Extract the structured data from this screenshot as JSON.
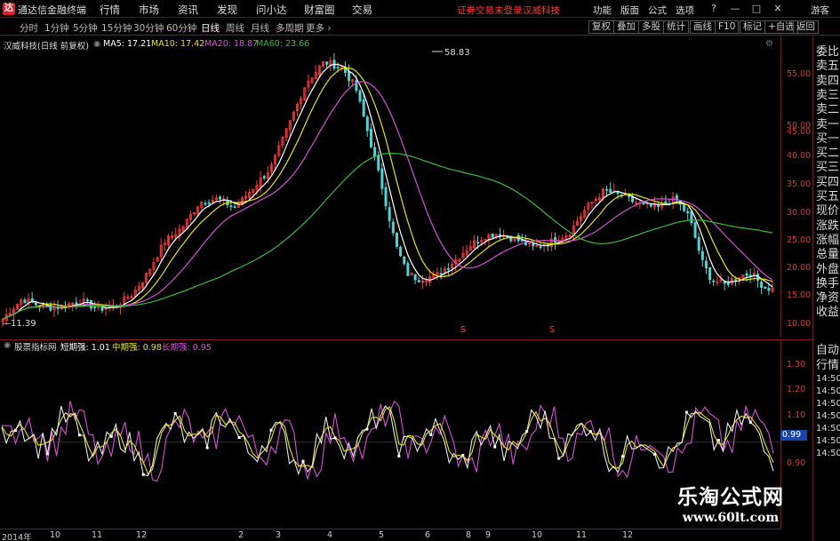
{
  "app": {
    "title": "通达信金融终端",
    "logo_glyph": "达"
  },
  "menu": [
    "行情",
    "市场",
    "资讯",
    "发现",
    "问小达",
    "财富圈",
    "交易"
  ],
  "status_warning": "证券交易未登录",
  "stock_tag": "汉威科技",
  "right_menu": [
    "功能",
    "版面",
    "公式",
    "选项"
  ],
  "window_buttons": [
    "?",
    "—",
    "□",
    "✕"
  ],
  "user_label": "游客",
  "periods": [
    "分时",
    "1分钟",
    "5分钟",
    "15分钟",
    "30分钟",
    "60分钟",
    "日线",
    "周线",
    "月线",
    "多周期",
    "更多 ›"
  ],
  "active_period": "日线",
  "toolbar": [
    "复权",
    "叠加",
    "多股",
    "统计",
    "画线",
    "F10",
    "标记",
    "+自选",
    "返回"
  ],
  "main_legend": {
    "stock": "汉威科技(日线 前复权)",
    "ma5": "MA5: 17.21",
    "ma10": "MA10: 17.42",
    "ma20": "MA20: 18.87",
    "ma60": "MA60: 23.66"
  },
  "sub_legend": {
    "name": "股票指标网",
    "short": "短期强: 1.01",
    "mid": "中期强: 0.98",
    "long": "长期强: 0.95"
  },
  "annotations": {
    "high": "58.83",
    "low": "11.39",
    "marker": "S"
  },
  "main_axis_ticks": [
    "55.00",
    "50.00",
    "45.00",
    "40.00",
    "35.00",
    "30.00",
    "25.00",
    "20.00",
    "15.00",
    "10.00"
  ],
  "sub_axis_ticks": [
    "1.30",
    "1.20",
    "1.10",
    "0.99",
    "0.90"
  ],
  "right_panel": [
    "委比",
    "卖五",
    "卖四",
    "卖三",
    "卖二",
    "卖一",
    "买一",
    "买二",
    "买三",
    "买四",
    "买五",
    "现价",
    "涨跌",
    "涨幅",
    "总量",
    "外盘",
    "换手",
    "净资",
    "收益",
    "自动",
    "行情",
    "14:50",
    "14:50",
    "14:50",
    "14:50",
    "14:50",
    "14:50",
    "14:50"
  ],
  "x_axis_ticks": [
    "2014年",
    "10",
    "11",
    "12",
    "2",
    "3",
    "4",
    "5",
    "6",
    "8",
    "9",
    "10",
    "11",
    "12"
  ],
  "watermark": {
    "title": "乐淘公式网",
    "url": "www.60lt.com"
  },
  "colors": {
    "ma5": "#ffffff",
    "ma10": "#e6e600",
    "ma20": "#d64fd6",
    "ma60": "#3cb83c",
    "up": "#ff3b3b",
    "down": "#4fd4d4",
    "frame": "#8a1414"
  }
}
